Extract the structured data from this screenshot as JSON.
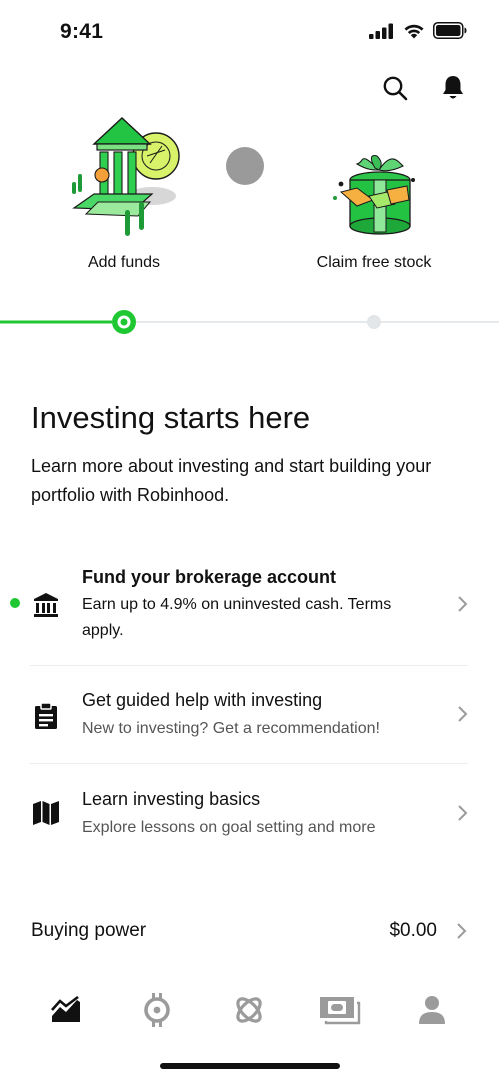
{
  "status_bar": {
    "time": "9:41"
  },
  "header": {
    "search_icon": "search-icon",
    "notifications_icon": "bell-icon"
  },
  "carousel": {
    "steps": [
      {
        "label": "Add funds",
        "state": "current"
      },
      {
        "label": "Claim free stock",
        "state": "upcoming"
      }
    ]
  },
  "intro": {
    "title": "Investing starts here",
    "description": "Learn more about investing and start building your portfolio with Robinhood."
  },
  "tasks": [
    {
      "title": "Fund your brokerage account",
      "description": "Earn up to 4.9% on uninvested cash. Terms apply.",
      "icon": "bank-icon",
      "active": true
    },
    {
      "title": "Get guided help with investing",
      "description": "New to investing? Get a recommendation!",
      "icon": "clipboard-icon",
      "active": false
    },
    {
      "title": "Learn investing basics",
      "description": "Explore lessons on goal setting and more",
      "icon": "map-icon",
      "active": false
    }
  ],
  "buying_power": {
    "label": "Buying power",
    "value": "$0.00"
  },
  "tab_bar": {
    "tabs": [
      {
        "icon": "chart-icon",
        "active": true
      },
      {
        "icon": "crypto-icon",
        "active": false
      },
      {
        "icon": "network-icon",
        "active": false
      },
      {
        "icon": "cash-icon",
        "active": false
      },
      {
        "icon": "account-icon",
        "active": false
      }
    ]
  },
  "colors": {
    "accent": "#1fc832",
    "inactive": "#9b9b9b",
    "text": "#111111",
    "secondary": "#555555"
  }
}
